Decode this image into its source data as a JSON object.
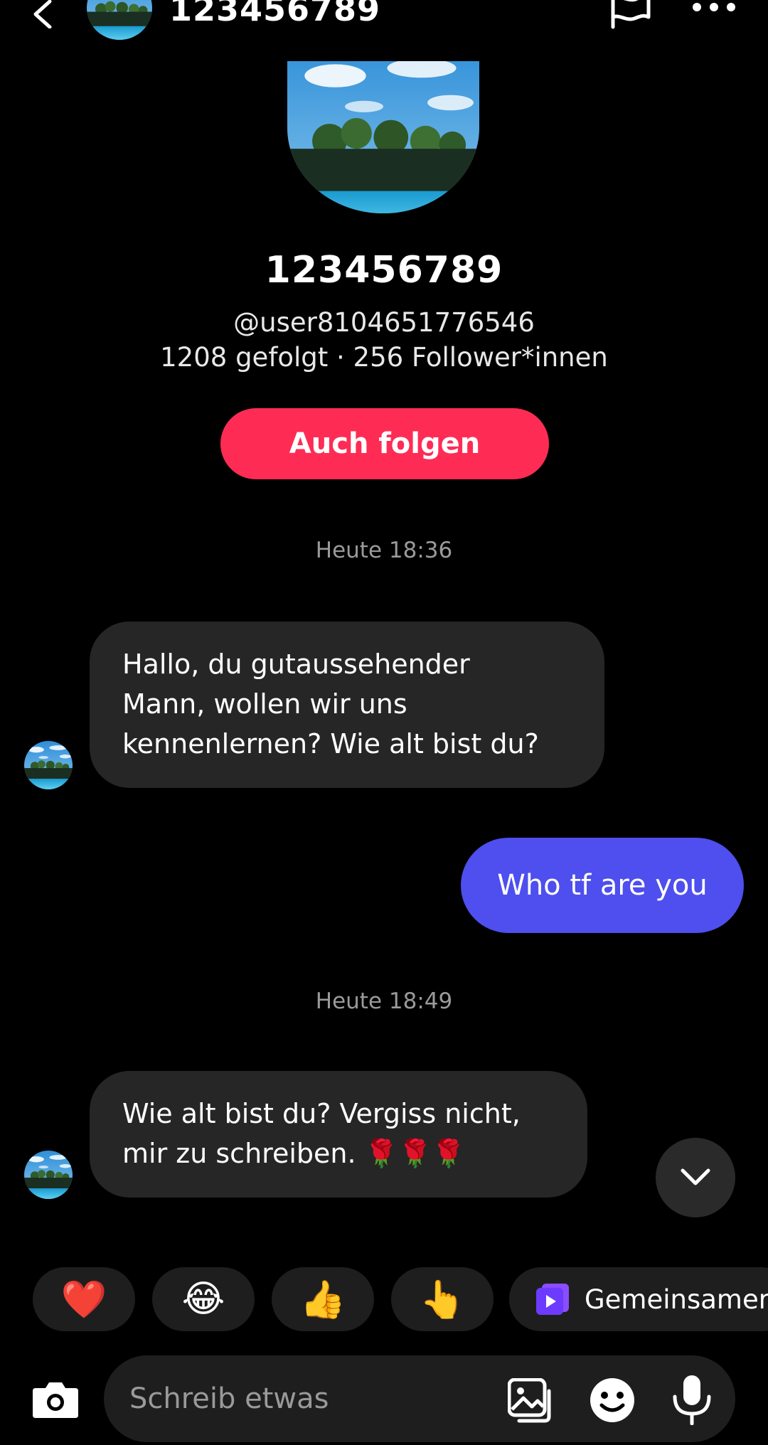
{
  "header": {
    "title": "123456789",
    "back_icon": "chevron-left-icon",
    "flag_icon": "flag-icon",
    "more_icon": "more-horizontal-icon"
  },
  "profile": {
    "name": "123456789",
    "handle": "@user8104651776546",
    "stats": "1208 gefolgt · 256 Follower*innen",
    "follow_label": "Auch folgen",
    "follow_color": "#fe2c55"
  },
  "chat": {
    "timestamp_1": "Heute 18:36",
    "timestamp_2": "Heute 18:49",
    "messages": [
      {
        "from": "other",
        "lines": [
          "Hallo, du gutaussehender",
          "Mann, wollen wir uns",
          "kennenlernen? Wie alt bist du?"
        ]
      },
      {
        "from": "me",
        "text": "Who tf are you",
        "color": "#4e4fee"
      },
      {
        "from": "other",
        "lines": [
          "Wie alt bist du? Vergiss nicht,",
          "mir zu schreiben. 🌹🌹🌹"
        ]
      }
    ]
  },
  "quick_reactions": {
    "heart": "❤️",
    "laugh": "😂",
    "thumbs_up": "👍",
    "point": "👆",
    "together_label": "Gemeinsamer"
  },
  "composer": {
    "placeholder": "Schreib etwas",
    "camera_icon": "camera-icon",
    "gallery_icon": "gallery-icon",
    "sticker_icon": "emoji-sticker-icon",
    "mic_icon": "microphone-icon"
  }
}
